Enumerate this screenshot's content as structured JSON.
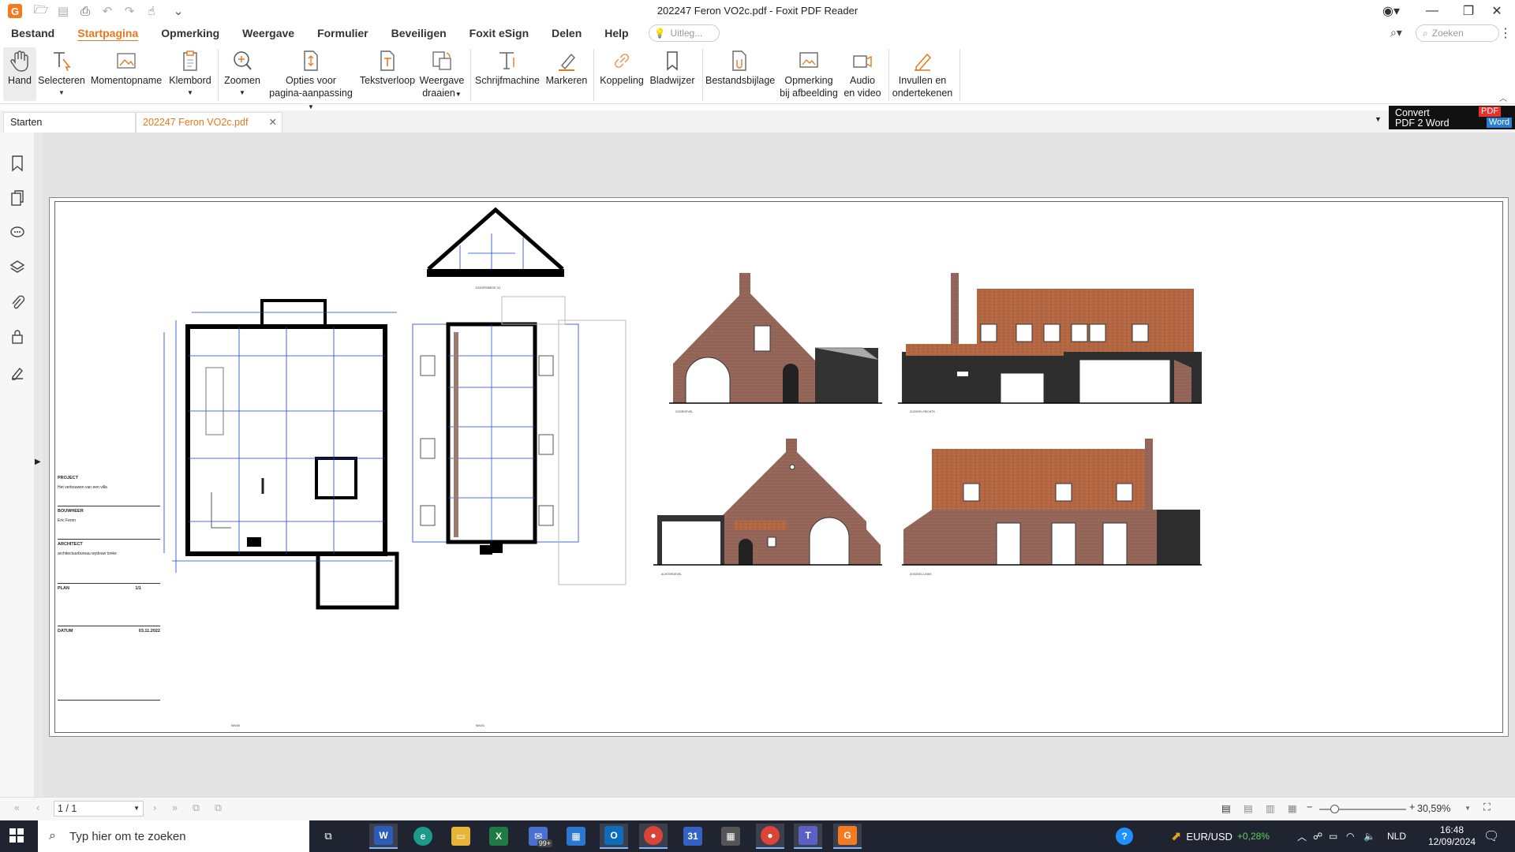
{
  "window": {
    "title": "202247 Feron VO2c.pdf - Foxit PDF Reader"
  },
  "menu": {
    "items": [
      "Bestand",
      "Startpagina",
      "Opmerking",
      "Weergave",
      "Formulier",
      "Beveiligen",
      "Foxit eSign",
      "Delen",
      "Help"
    ],
    "tellme_placeholder": "Uitleg...",
    "search_placeholder": "Zoeken"
  },
  "ribbon": {
    "hand": "Hand",
    "select": "Selecteren",
    "snapshot": "Momentopname",
    "clipboard": "Klembord",
    "zoom": "Zoomen",
    "pagefit_1": "Opties voor",
    "pagefit_2": "pagina-aanpassing",
    "reflow": "Tekstverloop",
    "rotate_1": "Weergave",
    "rotate_2": "draaien",
    "typewriter": "Schrijfmachine",
    "highlight": "Markeren",
    "link": "Koppeling",
    "bookmark": "Bladwijzer",
    "attachment": "Bestandsbijlage",
    "imgannot_1": "Opmerking",
    "imgannot_2": "bij afbeelding",
    "av_1": "Audio",
    "av_2": "en video",
    "fillsign_1": "Invullen en",
    "fillsign_2": "ondertekenen"
  },
  "tabs": {
    "start": "Starten",
    "doc": "202247 Feron VO2c.pdf"
  },
  "convert": {
    "line1": "Convert",
    "line2": "PDF 2 Word",
    "badge1": "PDF",
    "badge2": "Word"
  },
  "drawing": {
    "project_label": "PROJECT",
    "project_name": "Het verbouwen van een villa",
    "bouwheer_label": "BOUWHEER",
    "bouwheer_name": "Eric Feron",
    "architect_label": "ARCHITECT",
    "architect_name": "architectuurbureau wydouw tonke",
    "plan_label": "PLAN",
    "plan_value": "1/1",
    "datum_label": "DATUM",
    "datum_value": "03.11.2022"
  },
  "status": {
    "page": "1 / 1",
    "zoom": "30,59%"
  },
  "taskbar": {
    "search": "Typ hier om te zoeken",
    "fx_label": "EUR/USD",
    "fx_change": "+0,28%",
    "lang": "NLD",
    "time": "16:48",
    "date": "12/09/2024",
    "outlook_badge": "99+"
  },
  "colors": {
    "accent": "#e8781e",
    "blueprint": "#1f3fd0",
    "brick": "#9a6a5c",
    "roof": "#b86a45"
  }
}
